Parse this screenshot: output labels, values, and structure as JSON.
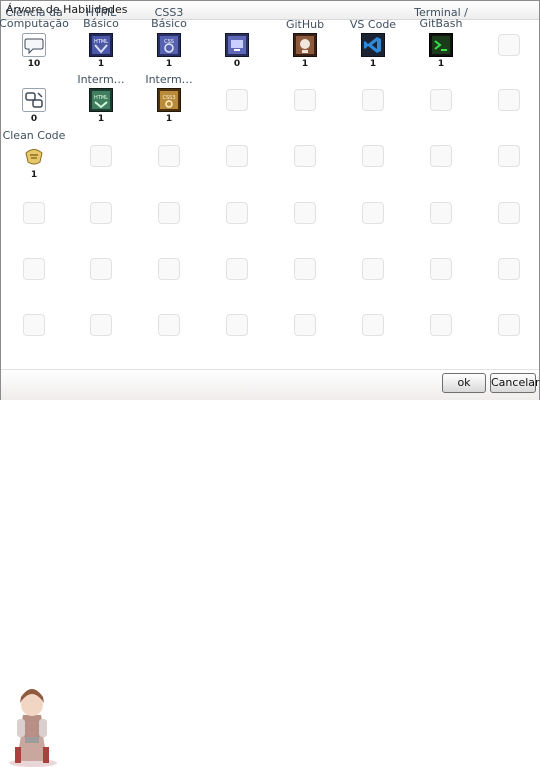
{
  "window": {
    "title": "Árvore de Habilidades"
  },
  "buttons": {
    "ok": "ok",
    "cancel": "Cancelar"
  },
  "rows": [
    [
      {
        "label": "Ciência da Computação",
        "label_lines": [
          "Ciência da",
          "Computação"
        ],
        "icon": "chat-bubble-icon",
        "count": "10"
      },
      {
        "label": "HTML Básico",
        "label_lines": [
          "HTML",
          "Básico"
        ],
        "icon": "html-icon",
        "count": "1"
      },
      {
        "label": "CSS3 Básico",
        "label_lines": [
          "CSS3",
          "Básico"
        ],
        "icon": "css3-icon",
        "count": "1"
      },
      {
        "label": "",
        "label_lines": [],
        "icon": "monitor-skill-icon",
        "count": "0"
      },
      {
        "label": "GitHub",
        "label_lines": [
          "GitHub"
        ],
        "icon": "github-icon",
        "count": "1"
      },
      {
        "label": "VS Code",
        "label_lines": [
          "VS Code"
        ],
        "icon": "vscode-icon",
        "count": "1"
      },
      {
        "label": "Terminal / GitBash",
        "label_lines": [
          "Terminal /",
          "GitBash"
        ],
        "icon": "terminal-icon",
        "count": "1"
      },
      null
    ],
    [
      {
        "label": "",
        "label_lines": [],
        "icon": "broken-link-icon",
        "count": "0"
      },
      {
        "label": "Interm…",
        "label_lines": [
          "Interm…"
        ],
        "icon": "html-intermediate-icon",
        "count": "1"
      },
      {
        "label": "Interm…",
        "label_lines": [
          "Interm…"
        ],
        "icon": "css3-intermediate-icon",
        "count": "1"
      },
      null,
      null,
      null,
      null,
      null
    ],
    [
      {
        "label": "Clean Code",
        "label_lines": [
          "Clean Code"
        ],
        "icon": "clean-code-icon",
        "count": "1"
      },
      null,
      null,
      null,
      null,
      null,
      null,
      null
    ],
    [
      null,
      null,
      null,
      null,
      null,
      null,
      null,
      null
    ],
    [
      null,
      null,
      null,
      null,
      null,
      null,
      null,
      null
    ],
    [
      null,
      null,
      null,
      null,
      null,
      null,
      null,
      null
    ]
  ]
}
